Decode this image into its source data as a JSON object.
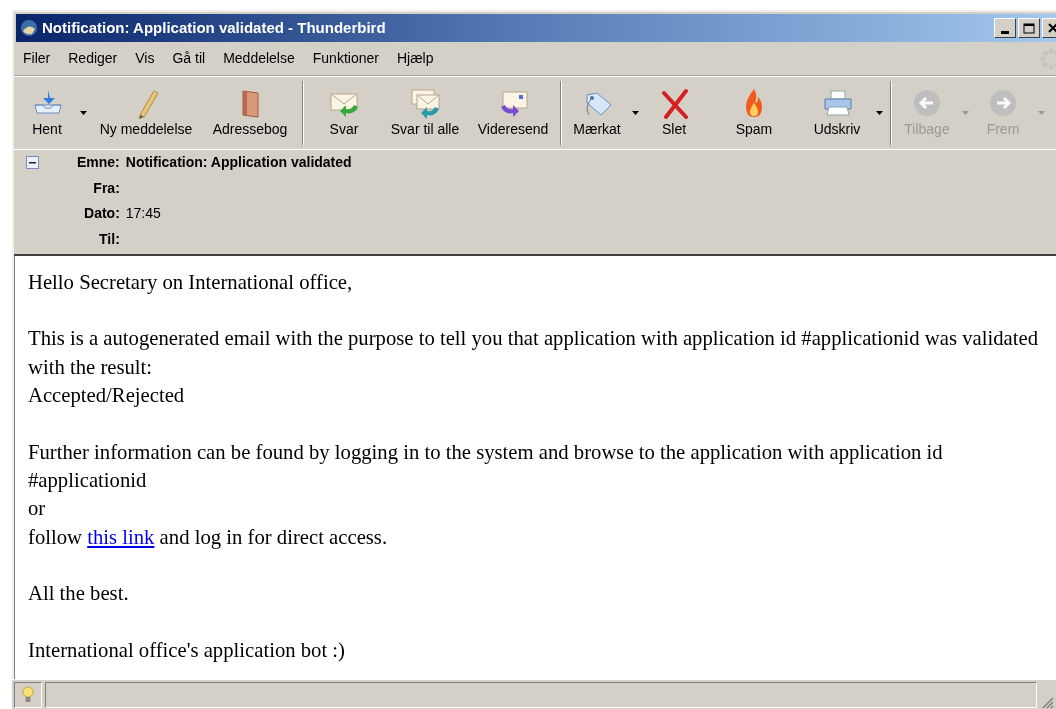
{
  "window": {
    "title": "Notification: Application validated - Thunderbird"
  },
  "menu": [
    "Filer",
    "Rediger",
    "Vis",
    "Gå til",
    "Meddelelse",
    "Funktioner",
    "Hjælp"
  ],
  "toolbar": [
    {
      "kind": "button",
      "label": "Hent",
      "dropdown": true,
      "disabled": false
    },
    {
      "kind": "button",
      "label": "Ny meddelelse",
      "dropdown": false,
      "disabled": false
    },
    {
      "kind": "button",
      "label": "Adressebog",
      "dropdown": false,
      "disabled": false
    },
    {
      "kind": "separator"
    },
    {
      "kind": "button",
      "label": "Svar",
      "dropdown": false,
      "disabled": false
    },
    {
      "kind": "button",
      "label": "Svar til alle",
      "dropdown": false,
      "disabled": false
    },
    {
      "kind": "button",
      "label": "Videresend",
      "dropdown": false,
      "disabled": false
    },
    {
      "kind": "separator"
    },
    {
      "kind": "button",
      "label": "Mærkat",
      "dropdown": true,
      "disabled": false
    },
    {
      "kind": "button",
      "label": "Slet",
      "dropdown": false,
      "disabled": false
    },
    {
      "kind": "button",
      "label": "Spam",
      "dropdown": false,
      "disabled": false
    },
    {
      "kind": "button",
      "label": "Udskriv",
      "dropdown": true,
      "disabled": false
    },
    {
      "kind": "separator"
    },
    {
      "kind": "button",
      "label": "Tilbage",
      "dropdown": true,
      "disabled": true
    },
    {
      "kind": "button",
      "label": "Frem",
      "dropdown": true,
      "disabled": true
    }
  ],
  "header": {
    "expanded": true,
    "fields": [
      {
        "label": "Emne:",
        "value": "Notification: Application validated",
        "bold": true
      },
      {
        "label": "Fra:"
      },
      {
        "label": "Dato:",
        "value": "17:45",
        "bold": false
      },
      {
        "label": "Til:"
      }
    ]
  },
  "body": {
    "paragraphs": [
      [
        [
          {
            "text": "Hello Secretary on International office,"
          }
        ]
      ],
      [
        [
          {
            "text": "This is a autogenerated email with the purpose to tell you that application with application id #applicationid was validated"
          }
        ],
        [
          {
            "text": "with the result:"
          }
        ],
        [
          {
            "text": "Accepted/Rejected"
          }
        ]
      ],
      [
        [
          {
            "text": "Further information can be found by logging in to the system and browse to the application with application id"
          }
        ],
        [
          {
            "text": "#applicationid"
          }
        ],
        [
          {
            "text": "or"
          }
        ],
        [
          {
            "text": "follow "
          },
          {
            "text": "this link",
            "kind": "link"
          },
          {
            "text": " and log in for direct access."
          }
        ]
      ],
      [
        [
          {
            "text": "All the best."
          }
        ]
      ],
      [
        [
          {
            "text": "International office's application bot :)"
          }
        ]
      ]
    ]
  }
}
